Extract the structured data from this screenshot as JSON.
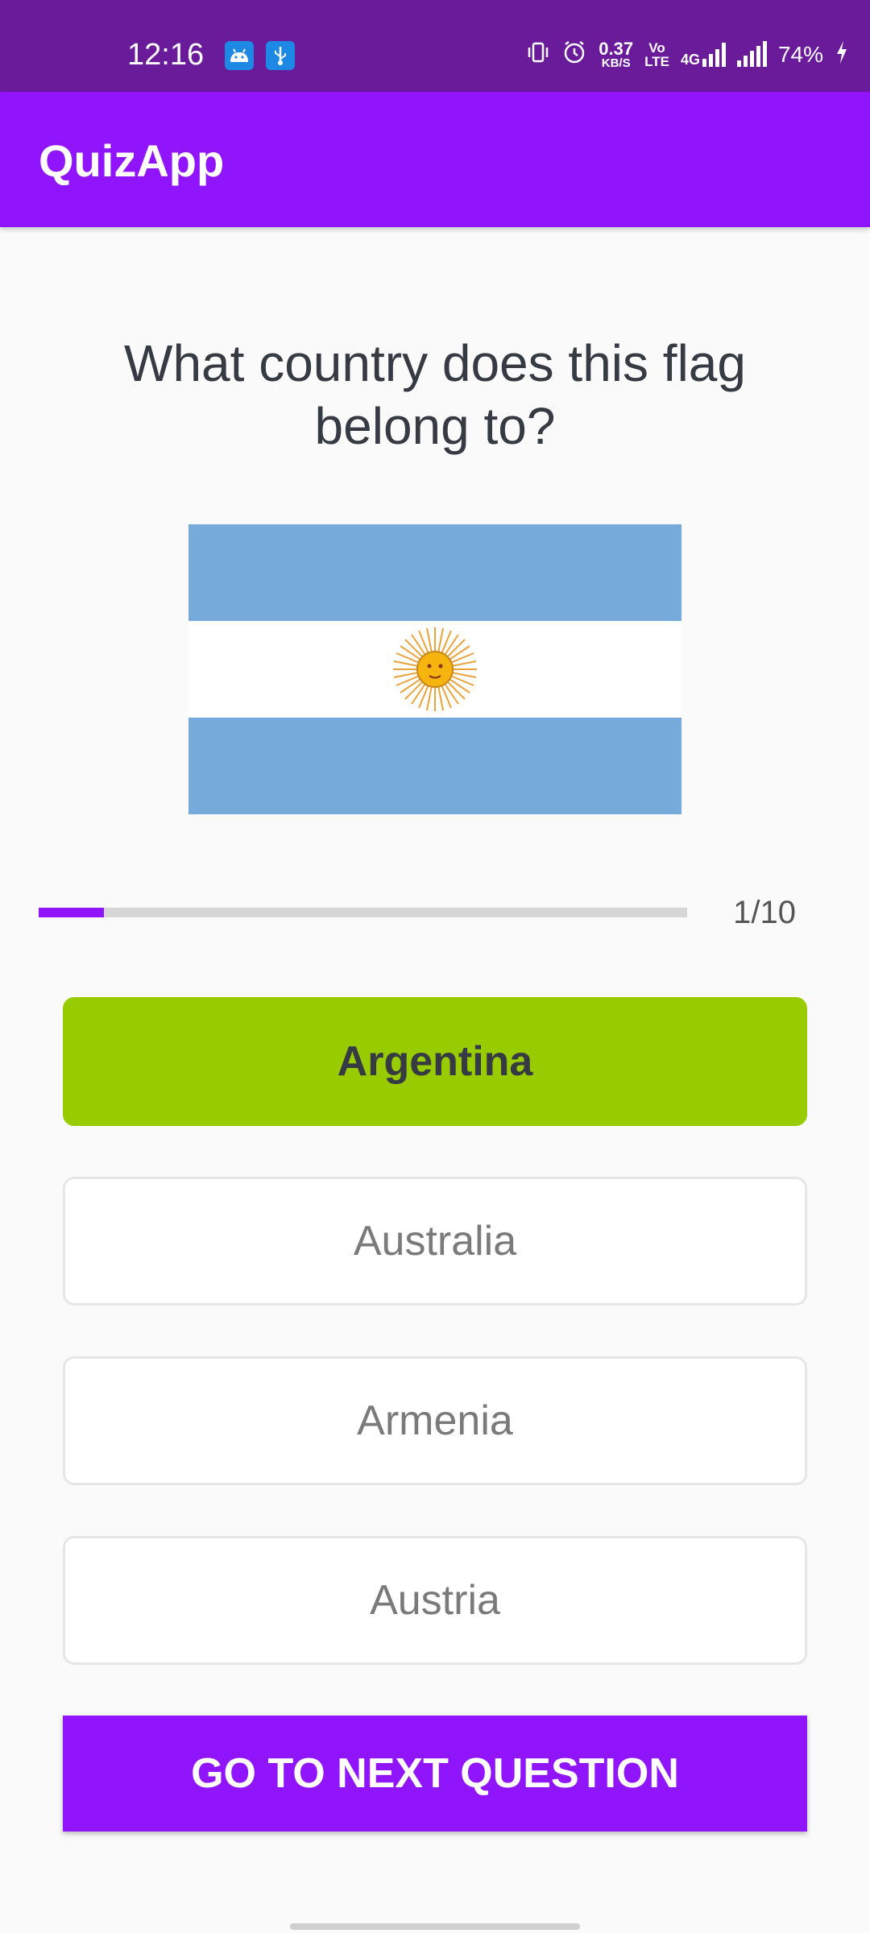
{
  "status_bar": {
    "time": "12:16",
    "net_speed_value": "0.37",
    "net_speed_unit": "KB/S",
    "volte_top": "Vo",
    "volte_bottom": "LTE",
    "network_type": "4G",
    "battery": "74%",
    "icons": [
      "android-icon",
      "usb-icon",
      "vibrate-icon",
      "alarm-icon",
      "signal-icon",
      "battery-charging-icon"
    ]
  },
  "app_bar": {
    "title": "QuizApp"
  },
  "question": {
    "text": "What country does this flag belong to?",
    "flag": "flag-argentina"
  },
  "progress": {
    "current": 1,
    "max": 10,
    "label": "1/10"
  },
  "options": [
    {
      "label": "Argentina",
      "state": "correct"
    },
    {
      "label": "Australia",
      "state": "default"
    },
    {
      "label": "Armenia",
      "state": "default"
    },
    {
      "label": "Austria",
      "state": "default"
    }
  ],
  "submit": {
    "label": "GO TO NEXT QUESTION"
  },
  "colors": {
    "status_bar": "#6a1b9a",
    "primary": "#9115fc",
    "correct": "#99cc00",
    "flag_blue": "#75aadb",
    "sun": "#f6b40e"
  }
}
